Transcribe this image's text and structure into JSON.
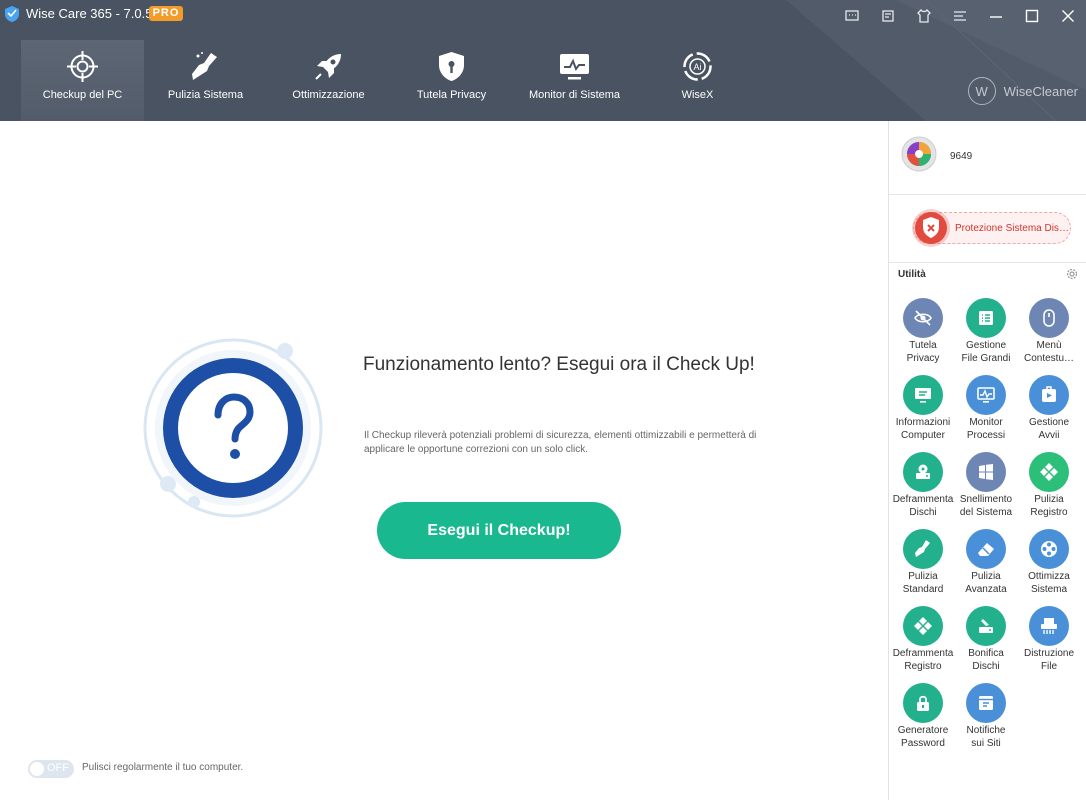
{
  "app": {
    "title": "Wise Care 365 - 7.0.5",
    "badge": "PRO",
    "brand": "WiseCleaner",
    "colors": {
      "header": "#4a5361",
      "accent": "#19b88f",
      "badge": "#f39c2a",
      "danger": "#e34a3f"
    }
  },
  "titlebar_icons": [
    "message-icon",
    "feedback-icon",
    "skin-icon",
    "menu-icon",
    "minimize-icon",
    "maximize-icon",
    "close-icon"
  ],
  "nav": {
    "tabs": [
      {
        "label": "Checkup del PC",
        "icon": "crosshair-icon",
        "active": true
      },
      {
        "label": "Pulizia Sistema",
        "icon": "broom-icon"
      },
      {
        "label": "Ottimizzazione",
        "icon": "rocket-icon"
      },
      {
        "label": "Tutela Privacy",
        "icon": "shield-icon"
      },
      {
        "label": "Monitor di Sistema",
        "icon": "monitor-icon"
      },
      {
        "label": "WiseX",
        "icon": "wisex-ai-icon"
      }
    ]
  },
  "main": {
    "heading": "Funzionamento lento? Esegui ora il Check Up!",
    "description": "Il Checkup rileverà potenziali problemi di sicurezza, elementi ottimizzabili e permetterà di applicare le opportune correzioni con un solo click.",
    "button": "Esegui il Checkup!",
    "toggle_state": "OFF",
    "toggle_caption": "Pulisci regolarmente il tuo computer."
  },
  "sidebar": {
    "score": "9649",
    "protection": "Protezione Sistema Disattivata",
    "utilities_title": "Utilità",
    "utilities": [
      {
        "label": "Tutela\nPrivacy",
        "icon": "eye-slash-icon",
        "color": "#6d86b4"
      },
      {
        "label": "Gestione\nFile Grandi",
        "icon": "file-list-icon",
        "color": "#23b08c"
      },
      {
        "label": "Menù\nContestu…",
        "icon": "mouse-icon",
        "color": "#6d86b4"
      },
      {
        "label": "Informazioni\nComputer",
        "icon": "computer-info-icon",
        "color": "#23b08c"
      },
      {
        "label": "Monitor\nProcessi",
        "icon": "process-monitor-icon",
        "color": "#4a90d9"
      },
      {
        "label": "Gestione\nAvvii",
        "icon": "startup-icon",
        "color": "#4a90d9"
      },
      {
        "label": "Deframmenta\nDischi",
        "icon": "disk-defrag-icon",
        "color": "#23b08c"
      },
      {
        "label": "Snellimento\ndel Sistema",
        "icon": "windows-icon",
        "color": "#6d86b4"
      },
      {
        "label": "Pulizia\nRegistro",
        "icon": "registry-clean-icon",
        "color": "#2bbf7a"
      },
      {
        "label": "Pulizia\nStandard",
        "icon": "broom-icon",
        "color": "#23b08c"
      },
      {
        "label": "Pulizia\nAvanzata",
        "icon": "eraser-icon",
        "color": "#4a90d9"
      },
      {
        "label": "Ottimizza\nSistema",
        "icon": "gear-flower-icon",
        "color": "#4a90d9"
      },
      {
        "label": "Deframmenta\nRegistro",
        "icon": "registry-defrag-icon",
        "color": "#23b08c"
      },
      {
        "label": "Bonifica\nDischi",
        "icon": "disk-wipe-icon",
        "color": "#23b08c"
      },
      {
        "label": "Distruzione\nFile",
        "icon": "shredder-icon",
        "color": "#4a90d9"
      },
      {
        "label": "Generatore\nPassword",
        "icon": "password-icon",
        "color": "#23b08c"
      },
      {
        "label": "Notifiche\nsui Siti",
        "icon": "site-notify-icon",
        "color": "#4a90d9"
      }
    ]
  }
}
